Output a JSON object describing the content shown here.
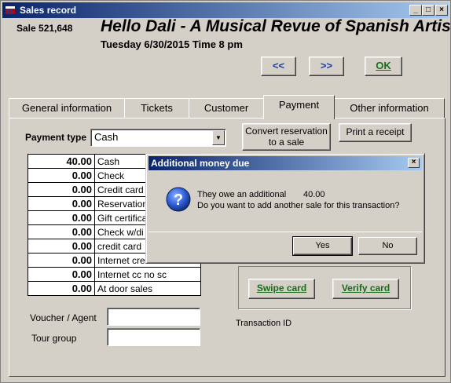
{
  "window": {
    "title": "Sales record",
    "minimize_glyph": "_",
    "maximize_glyph": "□",
    "close_glyph": "×"
  },
  "header": {
    "sale_number": "Sale 521,648",
    "event_title": "Hello Dali - A Musical Revue of Spanish Artists",
    "event_datetime": "Tuesday 6/30/2015  Time 8 pm"
  },
  "nav": {
    "prev_label": "<<",
    "next_label": ">>",
    "ok_label": "OK"
  },
  "tabs": [
    {
      "label": "General information",
      "active": false
    },
    {
      "label": "Tickets",
      "active": false
    },
    {
      "label": "Customer",
      "active": false
    },
    {
      "label": "Payment",
      "active": true
    },
    {
      "label": "Other information",
      "active": false
    }
  ],
  "payment": {
    "type_label": "Payment type",
    "type_value": "Cash",
    "convert_button": "Convert reservation to a sale",
    "print_button": "Print a receipt",
    "rows": [
      {
        "amount": "40.00",
        "label": "Cash"
      },
      {
        "amount": "0.00",
        "label": "Check"
      },
      {
        "amount": "0.00",
        "label": "Credit card"
      },
      {
        "amount": "0.00",
        "label": "Reservation"
      },
      {
        "amount": "0.00",
        "label": "Gift certificate"
      },
      {
        "amount": "0.00",
        "label": "Check w/di"
      },
      {
        "amount": "0.00",
        "label": "credit card"
      },
      {
        "amount": "0.00",
        "label": "Internet cre"
      },
      {
        "amount": "0.00",
        "label": "Internet cc no sc"
      },
      {
        "amount": "0.00",
        "label": "At door sales"
      }
    ],
    "voucher_label": "Voucher / Agent",
    "voucher_value": "",
    "tour_label": "Tour group",
    "tour_value": "",
    "swipe_button": "Swipe card",
    "verify_button": "Verify card",
    "transaction_label": "Transaction ID"
  },
  "dialog": {
    "title": "Additional money due",
    "message_line1": "They owe an additional",
    "amount": "40.00",
    "message_line2": "Do you want to add another sale for this transaction?",
    "yes_label": "Yes",
    "no_label": "No",
    "close_glyph": "×",
    "icon": "question-icon"
  }
}
